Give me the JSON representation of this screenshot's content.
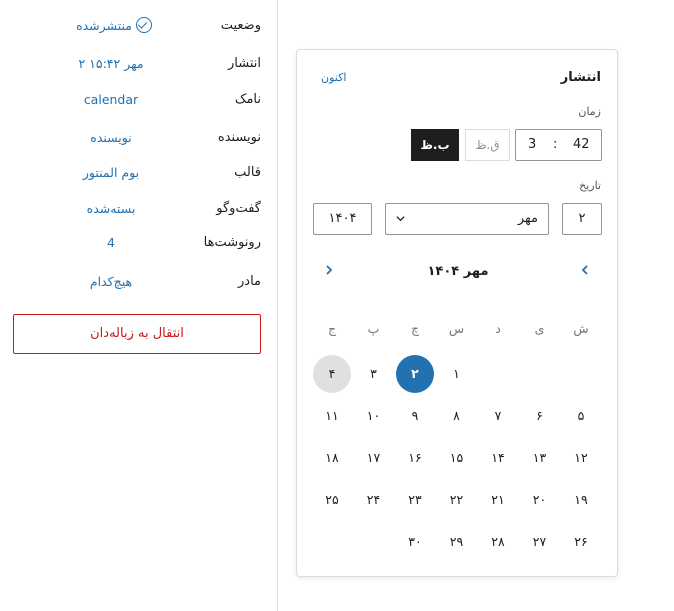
{
  "sidebar": {
    "status": {
      "label": "وضعیت",
      "value": "منتشرشده",
      "icon": "check-circle-icon"
    },
    "publish": {
      "label": "انتشار",
      "value": "۲ مهر ۱۵:۴۲"
    },
    "slug": {
      "label": "نامک",
      "value": "calendar"
    },
    "author": {
      "label": "نویسنده",
      "value": "نویسنده"
    },
    "template": {
      "label": "قالب",
      "value": "بوم المنتور"
    },
    "discussion": {
      "label": "گفت‌وگو",
      "value": "بسته‌شده"
    },
    "revisions": {
      "label": "رونوشت‌ها",
      "value": "4"
    },
    "parent": {
      "label": "مادر",
      "value": "هیچ‌کدام"
    },
    "trash_button": "انتقال به زباله‌دان"
  },
  "popover": {
    "title": "انتشار",
    "now_link": "اکنون",
    "time_label": "زمان",
    "hour": "3",
    "minute": "42",
    "time_sep": ":",
    "am_label": "ق.ظ",
    "pm_label": "ب.ظ",
    "pm_selected": true,
    "date_label": "تاریخ",
    "day": "۲",
    "month": "مهر",
    "year": "۱۴۰۴"
  },
  "calendar": {
    "heading": "مهر ۱۴۰۴",
    "prev_icon": "chevron-left-icon",
    "next_icon": "chevron-right-icon",
    "weekdays": [
      "ش",
      "ی",
      "د",
      "س",
      "چ",
      "پ",
      "ج"
    ],
    "weeks": [
      [
        "",
        "",
        "",
        "۱",
        "۲",
        "۳",
        "۴"
      ],
      [
        "۵",
        "۶",
        "۷",
        "۸",
        "۹",
        "۱۰",
        "۱۱"
      ],
      [
        "۱۲",
        "۱۳",
        "۱۴",
        "۱۵",
        "۱۶",
        "۱۷",
        "۱۸"
      ],
      [
        "۱۹",
        "۲۰",
        "۲۱",
        "۲۲",
        "۲۳",
        "۲۴",
        "۲۵"
      ],
      [
        "۲۶",
        "۲۷",
        "۲۸",
        "۲۹",
        "۳۰",
        "",
        ""
      ]
    ],
    "selected_day": "۲",
    "today_day": "۴"
  },
  "colors": {
    "accent": "#2271b1",
    "danger": "#cc1818",
    "today_bg": "#e0e0e0"
  }
}
